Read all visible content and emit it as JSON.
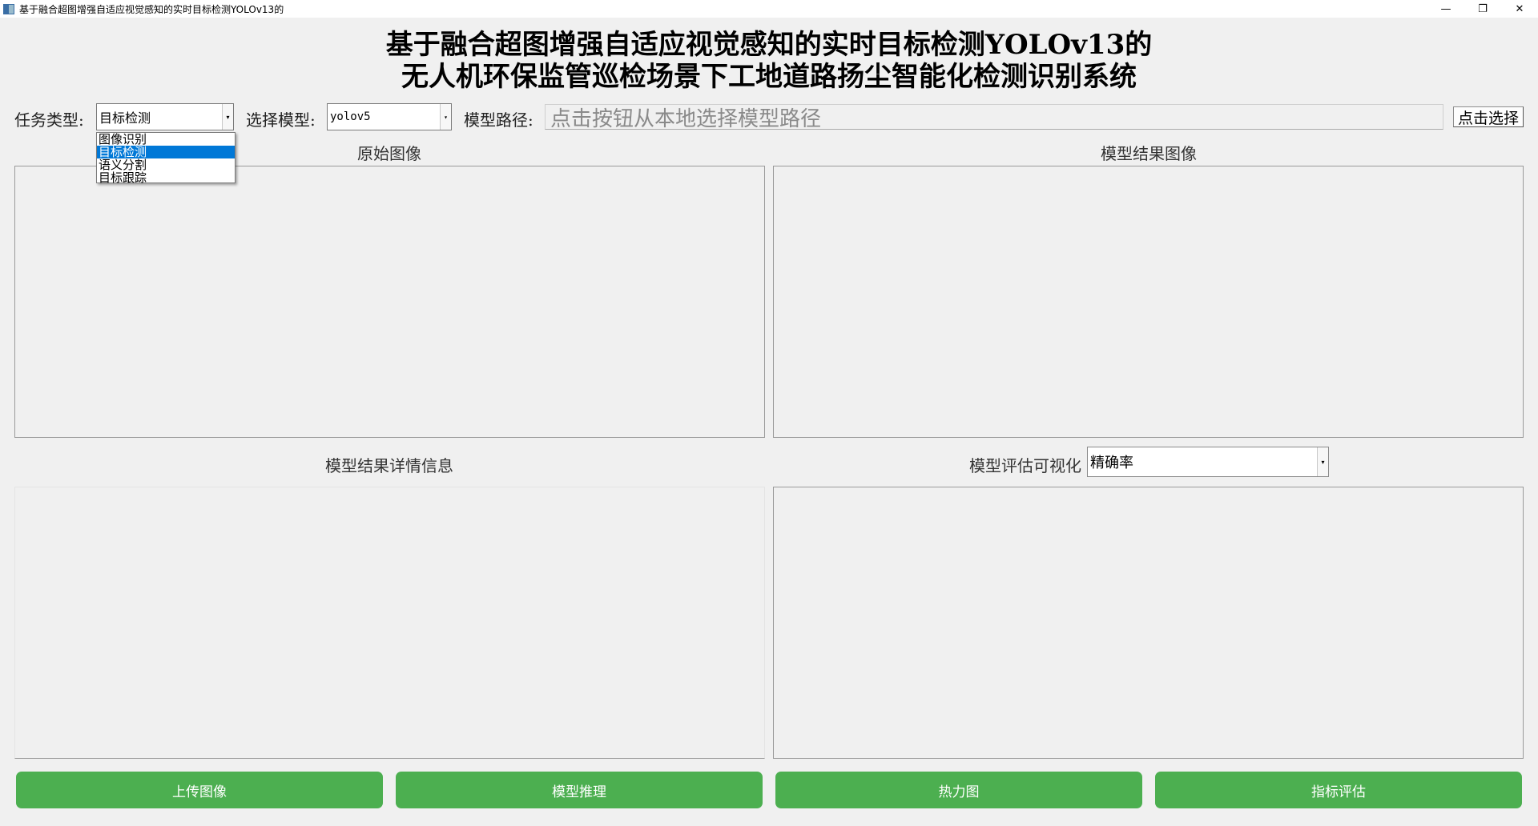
{
  "window": {
    "title": "基于融合超图增强自适应视觉感知的实时目标检测YOLOv13的",
    "controls": {
      "minimize": "—",
      "restore": "❐",
      "close": "✕"
    }
  },
  "heading": {
    "line1": "基于融合超图增强自适应视觉感知的实时目标检测YOLOv13的",
    "line2": "无人机环保监管巡检场景下工地道路扬尘智能化检测识别系统"
  },
  "controls": {
    "task_label": "任务类型:",
    "task_value": "目标检测",
    "model_label": "选择模型:",
    "model_value": "yolov5",
    "path_label": "模型路径:",
    "path_placeholder": "点击按钮从本地选择模型路径",
    "choose_button": "点击选择",
    "arrow_glyph": "▾"
  },
  "task_dropdown": {
    "options": [
      {
        "label": "图像识别",
        "selected": false
      },
      {
        "label": "目标检测",
        "selected": true
      },
      {
        "label": "语义分割",
        "selected": false
      },
      {
        "label": "目标跟踪",
        "selected": false
      }
    ]
  },
  "sections": {
    "original_image": "原始图像",
    "result_image": "模型结果图像",
    "result_details": "模型结果详情信息",
    "eval_visualization": "模型评估可视化",
    "eval_metric_value": "精确率"
  },
  "buttons": {
    "upload": "上传图像",
    "inference": "模型推理",
    "heatmap": "热力图",
    "metrics": "指标评估"
  },
  "colors": {
    "accent_green": "#4caf50",
    "selection_blue": "#0078d7"
  }
}
